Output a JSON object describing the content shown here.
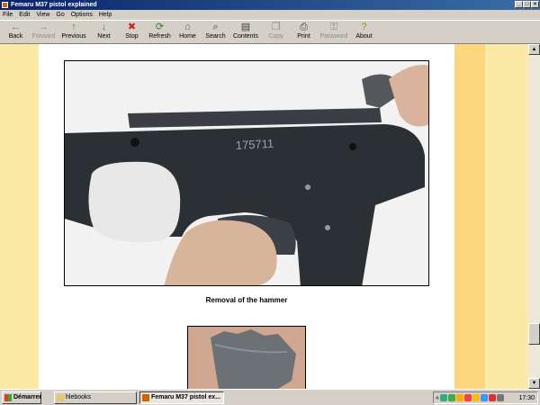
{
  "window": {
    "title": "Femaru M37 pistol explained"
  },
  "menu": [
    "File",
    "Edit",
    "View",
    "Go",
    "Options",
    "Help"
  ],
  "toolbar": [
    {
      "label": "Back",
      "icon": "←",
      "color": "#2a9d5c",
      "enabled": true
    },
    {
      "label": "Forward",
      "icon": "→",
      "color": "#8a8a8a",
      "enabled": false
    },
    {
      "label": "Previous",
      "icon": "↑",
      "color": "#2a9d2a",
      "enabled": true
    },
    {
      "label": "Next",
      "icon": "↓",
      "color": "#2a9d2a",
      "enabled": true
    },
    {
      "label": "Stop",
      "icon": "✖",
      "color": "#d02020",
      "enabled": true
    },
    {
      "label": "Refresh",
      "icon": "⟳",
      "color": "#2a7d2a",
      "enabled": true
    },
    {
      "label": "Home",
      "icon": "⌂",
      "color": "#7a5a2a",
      "enabled": true
    },
    {
      "label": "Search",
      "icon": "⌕",
      "color": "#404040",
      "enabled": true
    },
    {
      "label": "Contents",
      "icon": "▤",
      "color": "#404040",
      "enabled": true
    },
    {
      "label": "Copy",
      "icon": "❐",
      "color": "#8a8a8a",
      "enabled": false
    },
    {
      "label": "Print",
      "icon": "⎙",
      "color": "#404040",
      "enabled": true
    },
    {
      "label": "Password",
      "icon": "⚿",
      "color": "#8a8a8a",
      "enabled": false
    },
    {
      "label": "About",
      "icon": "?",
      "color": "#b08a00",
      "enabled": true
    }
  ],
  "content": {
    "photo1": {
      "serial": "175711"
    },
    "caption1": "Removal of the hammer"
  },
  "taskbar": {
    "start_label": "Démarrer",
    "tasks": [
      {
        "label": "hlebooks",
        "active": false
      },
      {
        "label": "Femaru M37 pistol ex...",
        "active": true
      }
    ],
    "clock": "17:30"
  }
}
